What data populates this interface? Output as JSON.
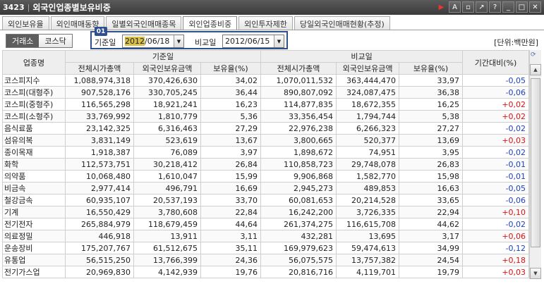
{
  "window": {
    "code": "3423",
    "title": "외국인업종별보유비중"
  },
  "tabs": [
    {
      "label": "외인보유율",
      "active": false
    },
    {
      "label": "외인매매동향",
      "active": false
    },
    {
      "label": "일별외국인매매종목",
      "active": false
    },
    {
      "label": "외인업종비중",
      "active": true
    },
    {
      "label": "외인투자제한",
      "active": false
    },
    {
      "label": "당일외국인매매현황(추정)",
      "active": false
    }
  ],
  "market": {
    "kospi_label": "거래소",
    "kosdaq_label": "코스닥"
  },
  "badge": "01",
  "dates": {
    "base_label": "기준일",
    "base_value": "2012/06/18",
    "compare_label": "비교일",
    "compare_value": "2012/06/15"
  },
  "unit_label": "[단위:백만원]",
  "table": {
    "headers": {
      "sector": "업종명",
      "base_group": "기준일",
      "compare_group": "비교일",
      "total_cap": "전체시가총액",
      "foreign_amt": "외국인보유금액",
      "ratio": "보유율(%)",
      "change": "기간대비(%)"
    },
    "rows": [
      {
        "name": "코스피지수",
        "b_cap": "1,088,974,318",
        "b_amt": "370,426,630",
        "b_pct": "34,02",
        "c_cap": "1,070,011,532",
        "c_amt": "363,444,470",
        "c_pct": "33,97",
        "chg": "-0,05",
        "dir": "neg"
      },
      {
        "name": "코스피(대형주)",
        "b_cap": "907,528,176",
        "b_amt": "330,705,245",
        "b_pct": "36,44",
        "c_cap": "890,807,092",
        "c_amt": "324,087,475",
        "c_pct": "36,38",
        "chg": "-0,06",
        "dir": "neg"
      },
      {
        "name": "코스피(중형주)",
        "b_cap": "116,565,298",
        "b_amt": "18,921,241",
        "b_pct": "16,23",
        "c_cap": "114,877,835",
        "c_amt": "18,672,355",
        "c_pct": "16,25",
        "chg": "+0,02",
        "dir": "pos"
      },
      {
        "name": "코스피(소형주)",
        "b_cap": "33,769,992",
        "b_amt": "1,810,779",
        "b_pct": "5,36",
        "c_cap": "33,356,454",
        "c_amt": "1,794,744",
        "c_pct": "5,38",
        "chg": "+0,02",
        "dir": "pos"
      },
      {
        "name": "음식료품",
        "b_cap": "23,142,325",
        "b_amt": "6,316,463",
        "b_pct": "27,29",
        "c_cap": "22,976,238",
        "c_amt": "6,266,323",
        "c_pct": "27,27",
        "chg": "-0,02",
        "dir": "neg"
      },
      {
        "name": "섬유의복",
        "b_cap": "3,831,149",
        "b_amt": "523,619",
        "b_pct": "13,67",
        "c_cap": "3,800,665",
        "c_amt": "520,377",
        "c_pct": "13,69",
        "chg": "+0,03",
        "dir": "pos"
      },
      {
        "name": "종이목재",
        "b_cap": "1,918,387",
        "b_amt": "76,089",
        "b_pct": "3,97",
        "c_cap": "1,898,672",
        "c_amt": "74,951",
        "c_pct": "3,95",
        "chg": "-0,02",
        "dir": "neg"
      },
      {
        "name": "화학",
        "b_cap": "112,573,751",
        "b_amt": "30,218,412",
        "b_pct": "26,84",
        "c_cap": "110,858,723",
        "c_amt": "29,748,078",
        "c_pct": "26,83",
        "chg": "-0,01",
        "dir": "neg"
      },
      {
        "name": "의약품",
        "b_cap": "10,068,480",
        "b_amt": "1,610,047",
        "b_pct": "15,99",
        "c_cap": "9,906,868",
        "c_amt": "1,582,770",
        "c_pct": "15,98",
        "chg": "-0,01",
        "dir": "neg"
      },
      {
        "name": "비금속",
        "b_cap": "2,977,414",
        "b_amt": "496,791",
        "b_pct": "16,69",
        "c_cap": "2,945,273",
        "c_amt": "489,853",
        "c_pct": "16,63",
        "chg": "-0,05",
        "dir": "neg"
      },
      {
        "name": "철강금속",
        "b_cap": "60,935,107",
        "b_amt": "20,537,193",
        "b_pct": "33,70",
        "c_cap": "60,081,653",
        "c_amt": "20,214,528",
        "c_pct": "33,65",
        "chg": "-0,06",
        "dir": "neg"
      },
      {
        "name": "기계",
        "b_cap": "16,550,429",
        "b_amt": "3,780,608",
        "b_pct": "22,84",
        "c_cap": "16,242,200",
        "c_amt": "3,726,335",
        "c_pct": "22,94",
        "chg": "+0,10",
        "dir": "pos"
      },
      {
        "name": "전기전자",
        "b_cap": "265,884,979",
        "b_amt": "118,679,459",
        "b_pct": "44,64",
        "c_cap": "261,374,275",
        "c_amt": "116,615,708",
        "c_pct": "44,62",
        "chg": "-0,02",
        "dir": "neg"
      },
      {
        "name": "의료정밀",
        "b_cap": "446,918",
        "b_amt": "13,911",
        "b_pct": "3,11",
        "c_cap": "432,281",
        "c_amt": "13,695",
        "c_pct": "3,17",
        "chg": "+0,06",
        "dir": "pos"
      },
      {
        "name": "운송장비",
        "b_cap": "175,207,767",
        "b_amt": "61,512,675",
        "b_pct": "35,11",
        "c_cap": "169,979,623",
        "c_amt": "59,474,613",
        "c_pct": "34,99",
        "chg": "-0,12",
        "dir": "neg"
      },
      {
        "name": "유통업",
        "b_cap": "56,515,250",
        "b_amt": "13,766,399",
        "b_pct": "24,36",
        "c_cap": "56,075,575",
        "c_amt": "13,757,382",
        "c_pct": "24,54",
        "chg": "+0,18",
        "dir": "pos"
      },
      {
        "name": "전기가스업",
        "b_cap": "20,969,830",
        "b_amt": "4,142,939",
        "b_pct": "19,76",
        "c_cap": "20,816,716",
        "c_amt": "4,119,701",
        "c_pct": "19,79",
        "chg": "+0,03",
        "dir": "pos"
      }
    ]
  },
  "colors": {
    "up": "#e01010",
    "down": "#1a3fc4",
    "accent": "#2f4f8f"
  }
}
